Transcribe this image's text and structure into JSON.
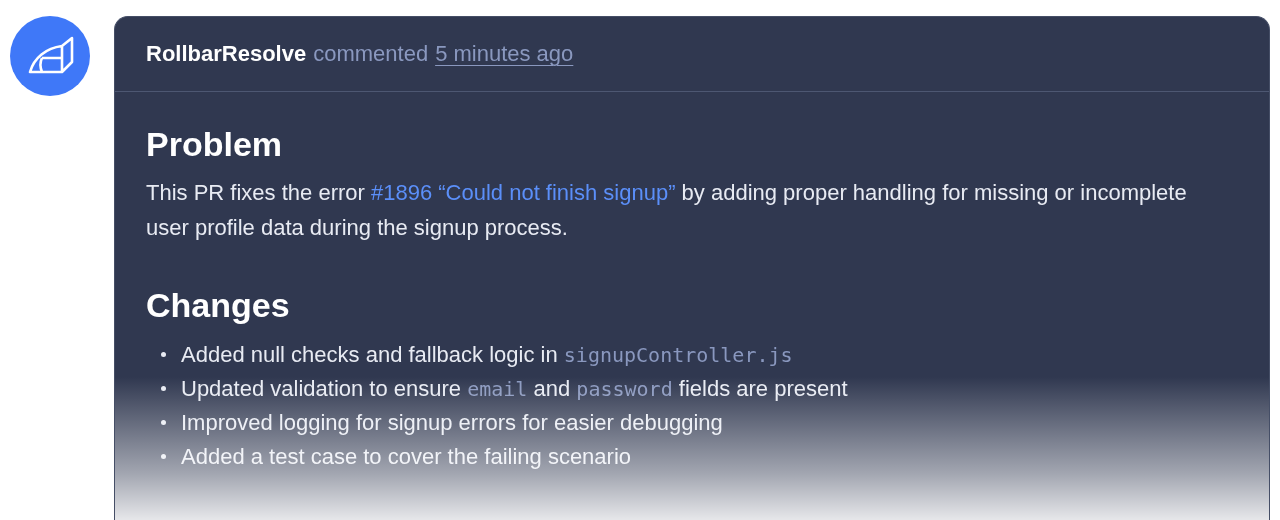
{
  "comment": {
    "author": "RollbarResolve",
    "action": "commented",
    "time": "5 minutes ago"
  },
  "sections": [
    {
      "heading": "Problem",
      "paragraph": [
        {
          "kind": "text",
          "text": "This PR fixes the error "
        },
        {
          "kind": "link",
          "text": "#1896 “Could not finish signup”"
        },
        {
          "kind": "text",
          "text": " by adding proper handling for missing or incomplete user profile data during the signup process."
        }
      ]
    },
    {
      "heading": "Changes",
      "bullets": [
        [
          {
            "kind": "text",
            "text": "Added null checks and fallback logic in "
          },
          {
            "kind": "code",
            "text": "signupController.js"
          }
        ],
        [
          {
            "kind": "text",
            "text": "Updated validation to ensure "
          },
          {
            "kind": "code",
            "text": "email"
          },
          {
            "kind": "text",
            "text": " and "
          },
          {
            "kind": "code",
            "text": "password"
          },
          {
            "kind": "text",
            "text": " fields are present"
          }
        ],
        [
          {
            "kind": "text",
            "text": "Improved logging for signup errors for easier debugging"
          }
        ],
        [
          {
            "kind": "text",
            "text": "Added a test case to cover the failing scenario"
          }
        ]
      ]
    }
  ]
}
